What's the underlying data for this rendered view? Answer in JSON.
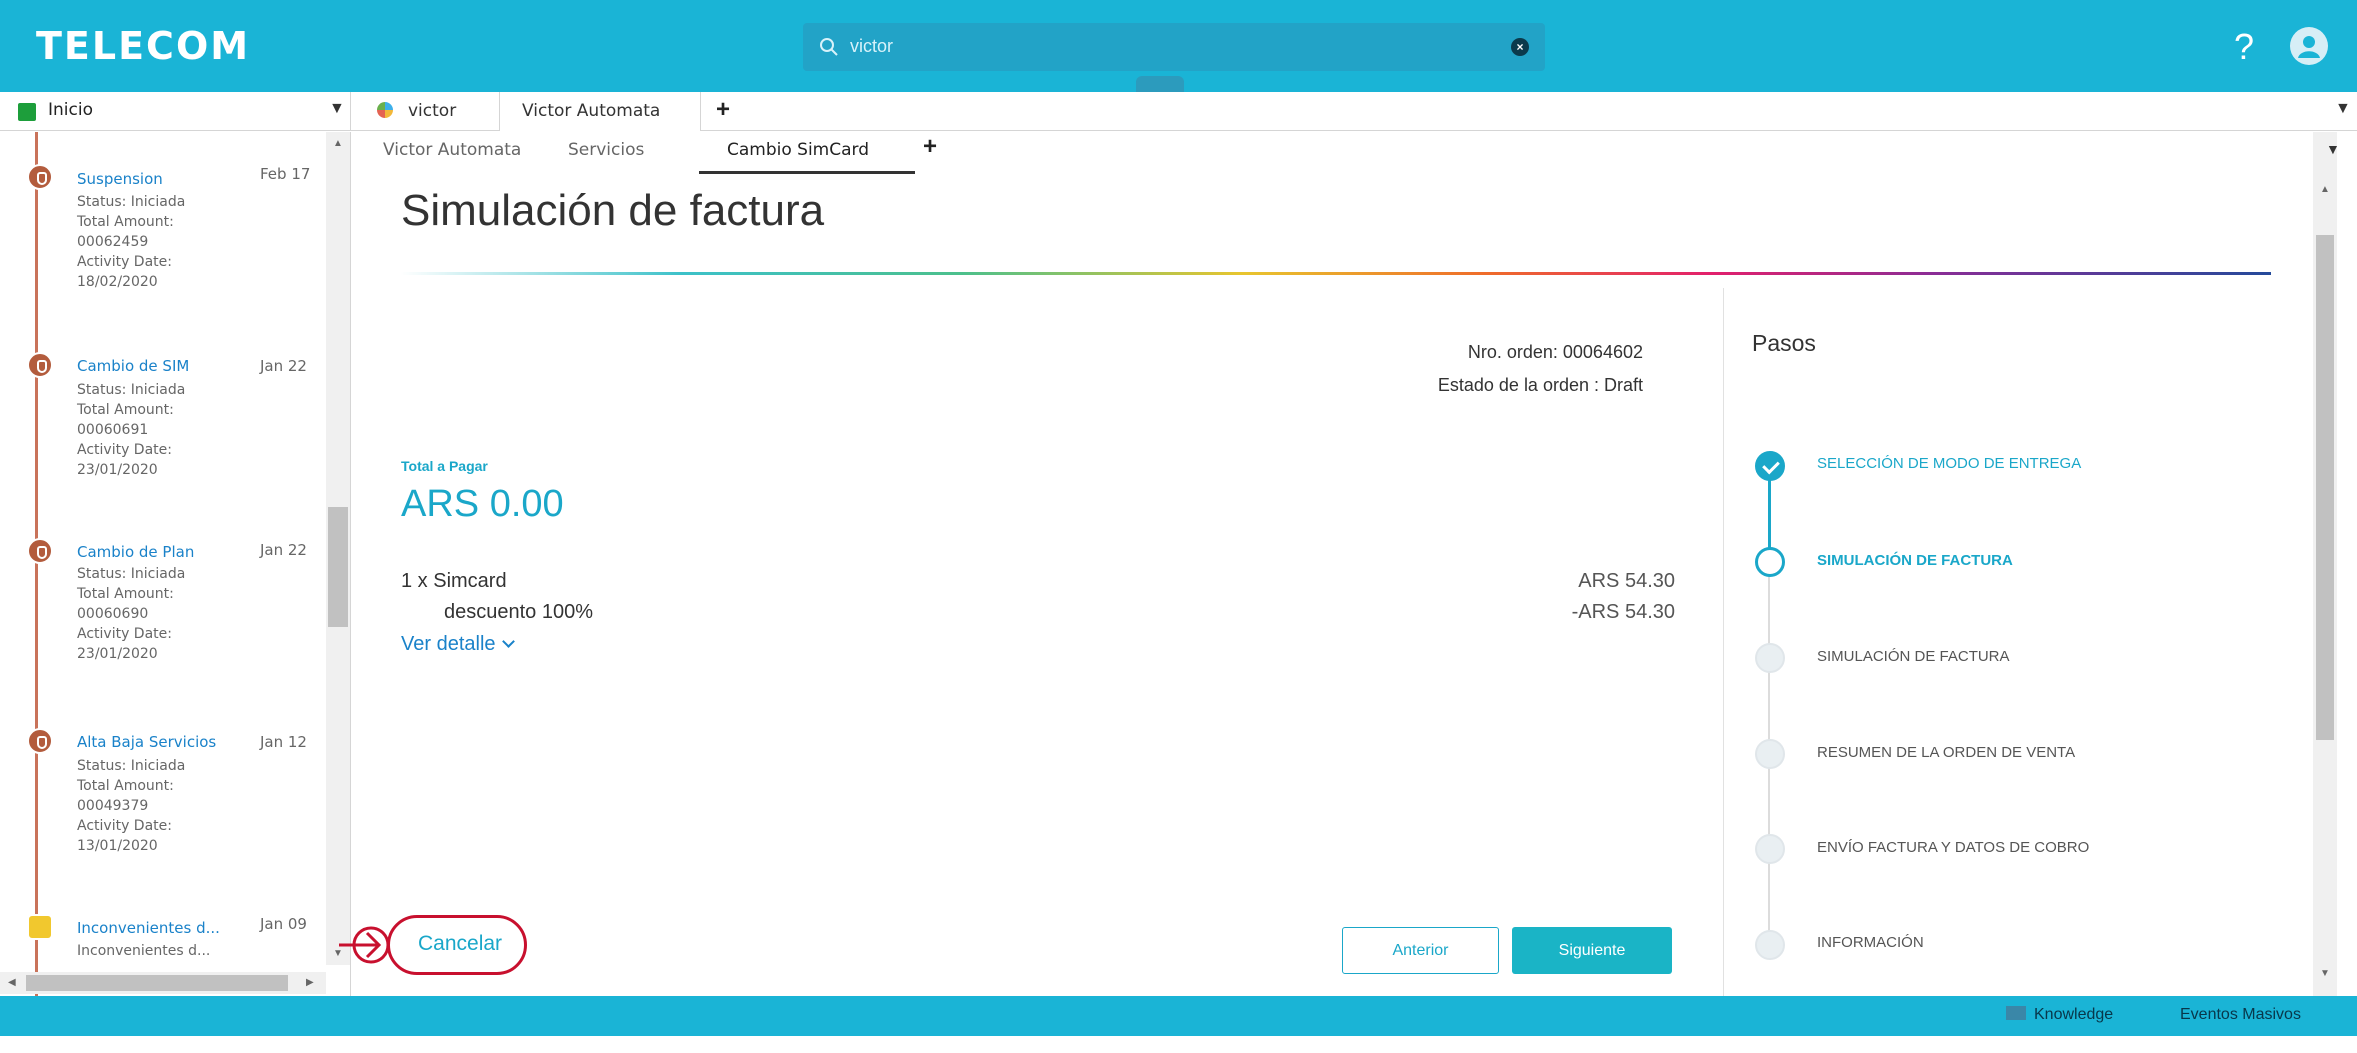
{
  "header": {
    "logo": "TELECOM",
    "search_value": "victor",
    "help_label": "?",
    "colors": {
      "bar": "#1ab4d6",
      "accent": "#1aa7c9"
    }
  },
  "tabs": {
    "home_label": "Inicio",
    "items": [
      {
        "label": "victor"
      },
      {
        "label": "Victor Automata"
      }
    ],
    "add_label": "+"
  },
  "sidebar": {
    "activities": [
      {
        "title": "Suspension",
        "date": "Feb 17",
        "details": "Status: Iniciada\nTotal Amount:\n00062459\nActivity Date:\n18/02/2020"
      },
      {
        "title": "Cambio de SIM",
        "date": "Jan 22",
        "details": "Status: Iniciada\nTotal Amount:\n00060691\nActivity Date:\n23/01/2020"
      },
      {
        "title": "Cambio de Plan",
        "date": "Jan 22",
        "details": "Status: Iniciada\nTotal Amount:\n00060690\nActivity Date:\n23/01/2020"
      },
      {
        "title": "Alta Baja Servicios",
        "date": "Jan 12",
        "details": "Status: Iniciada\nTotal Amount:\n00049379\nActivity Date:\n13/01/2020"
      },
      {
        "title": "Inconvenientes d...",
        "date": "Jan 09",
        "details": "Inconvenientes d..."
      }
    ]
  },
  "subtabs": {
    "items": [
      {
        "label": "Victor Automata"
      },
      {
        "label": "Servicios"
      },
      {
        "label": "Cambio SimCard"
      }
    ],
    "add_label": "+"
  },
  "main": {
    "title": "Simulación de factura",
    "order_number": "Nro. orden: 00064602",
    "order_state": "Estado de la orden : Draft",
    "total_label": "Total a Pagar",
    "total_amount": "ARS 0.00",
    "line_item": "1 x Simcard",
    "line_price": "ARS 54.30",
    "discount": "descuento 100%",
    "discount_price": "-ARS 54.30",
    "detail_link": "Ver detalle",
    "cancel_label": "Cancelar",
    "prev_label": "Anterior",
    "next_label": "Siguiente"
  },
  "steps": {
    "title": "Pasos",
    "items": [
      {
        "label": "SELECCIÓN DE MODO DE ENTREGA",
        "state": "done"
      },
      {
        "label": "SIMULACIÓN DE FACTURA",
        "state": "current"
      },
      {
        "label": "SIMULACIÓN DE FACTURA",
        "state": "pending"
      },
      {
        "label": "RESUMEN DE LA ORDEN DE VENTA",
        "state": "pending"
      },
      {
        "label": "ENVÍO FACTURA Y DATOS DE COBRO",
        "state": "pending"
      },
      {
        "label": "INFORMACIÓN",
        "state": "pending"
      }
    ]
  },
  "footer": {
    "knowledge_label": "Knowledge",
    "eventos_label": "Eventos Masivos"
  }
}
